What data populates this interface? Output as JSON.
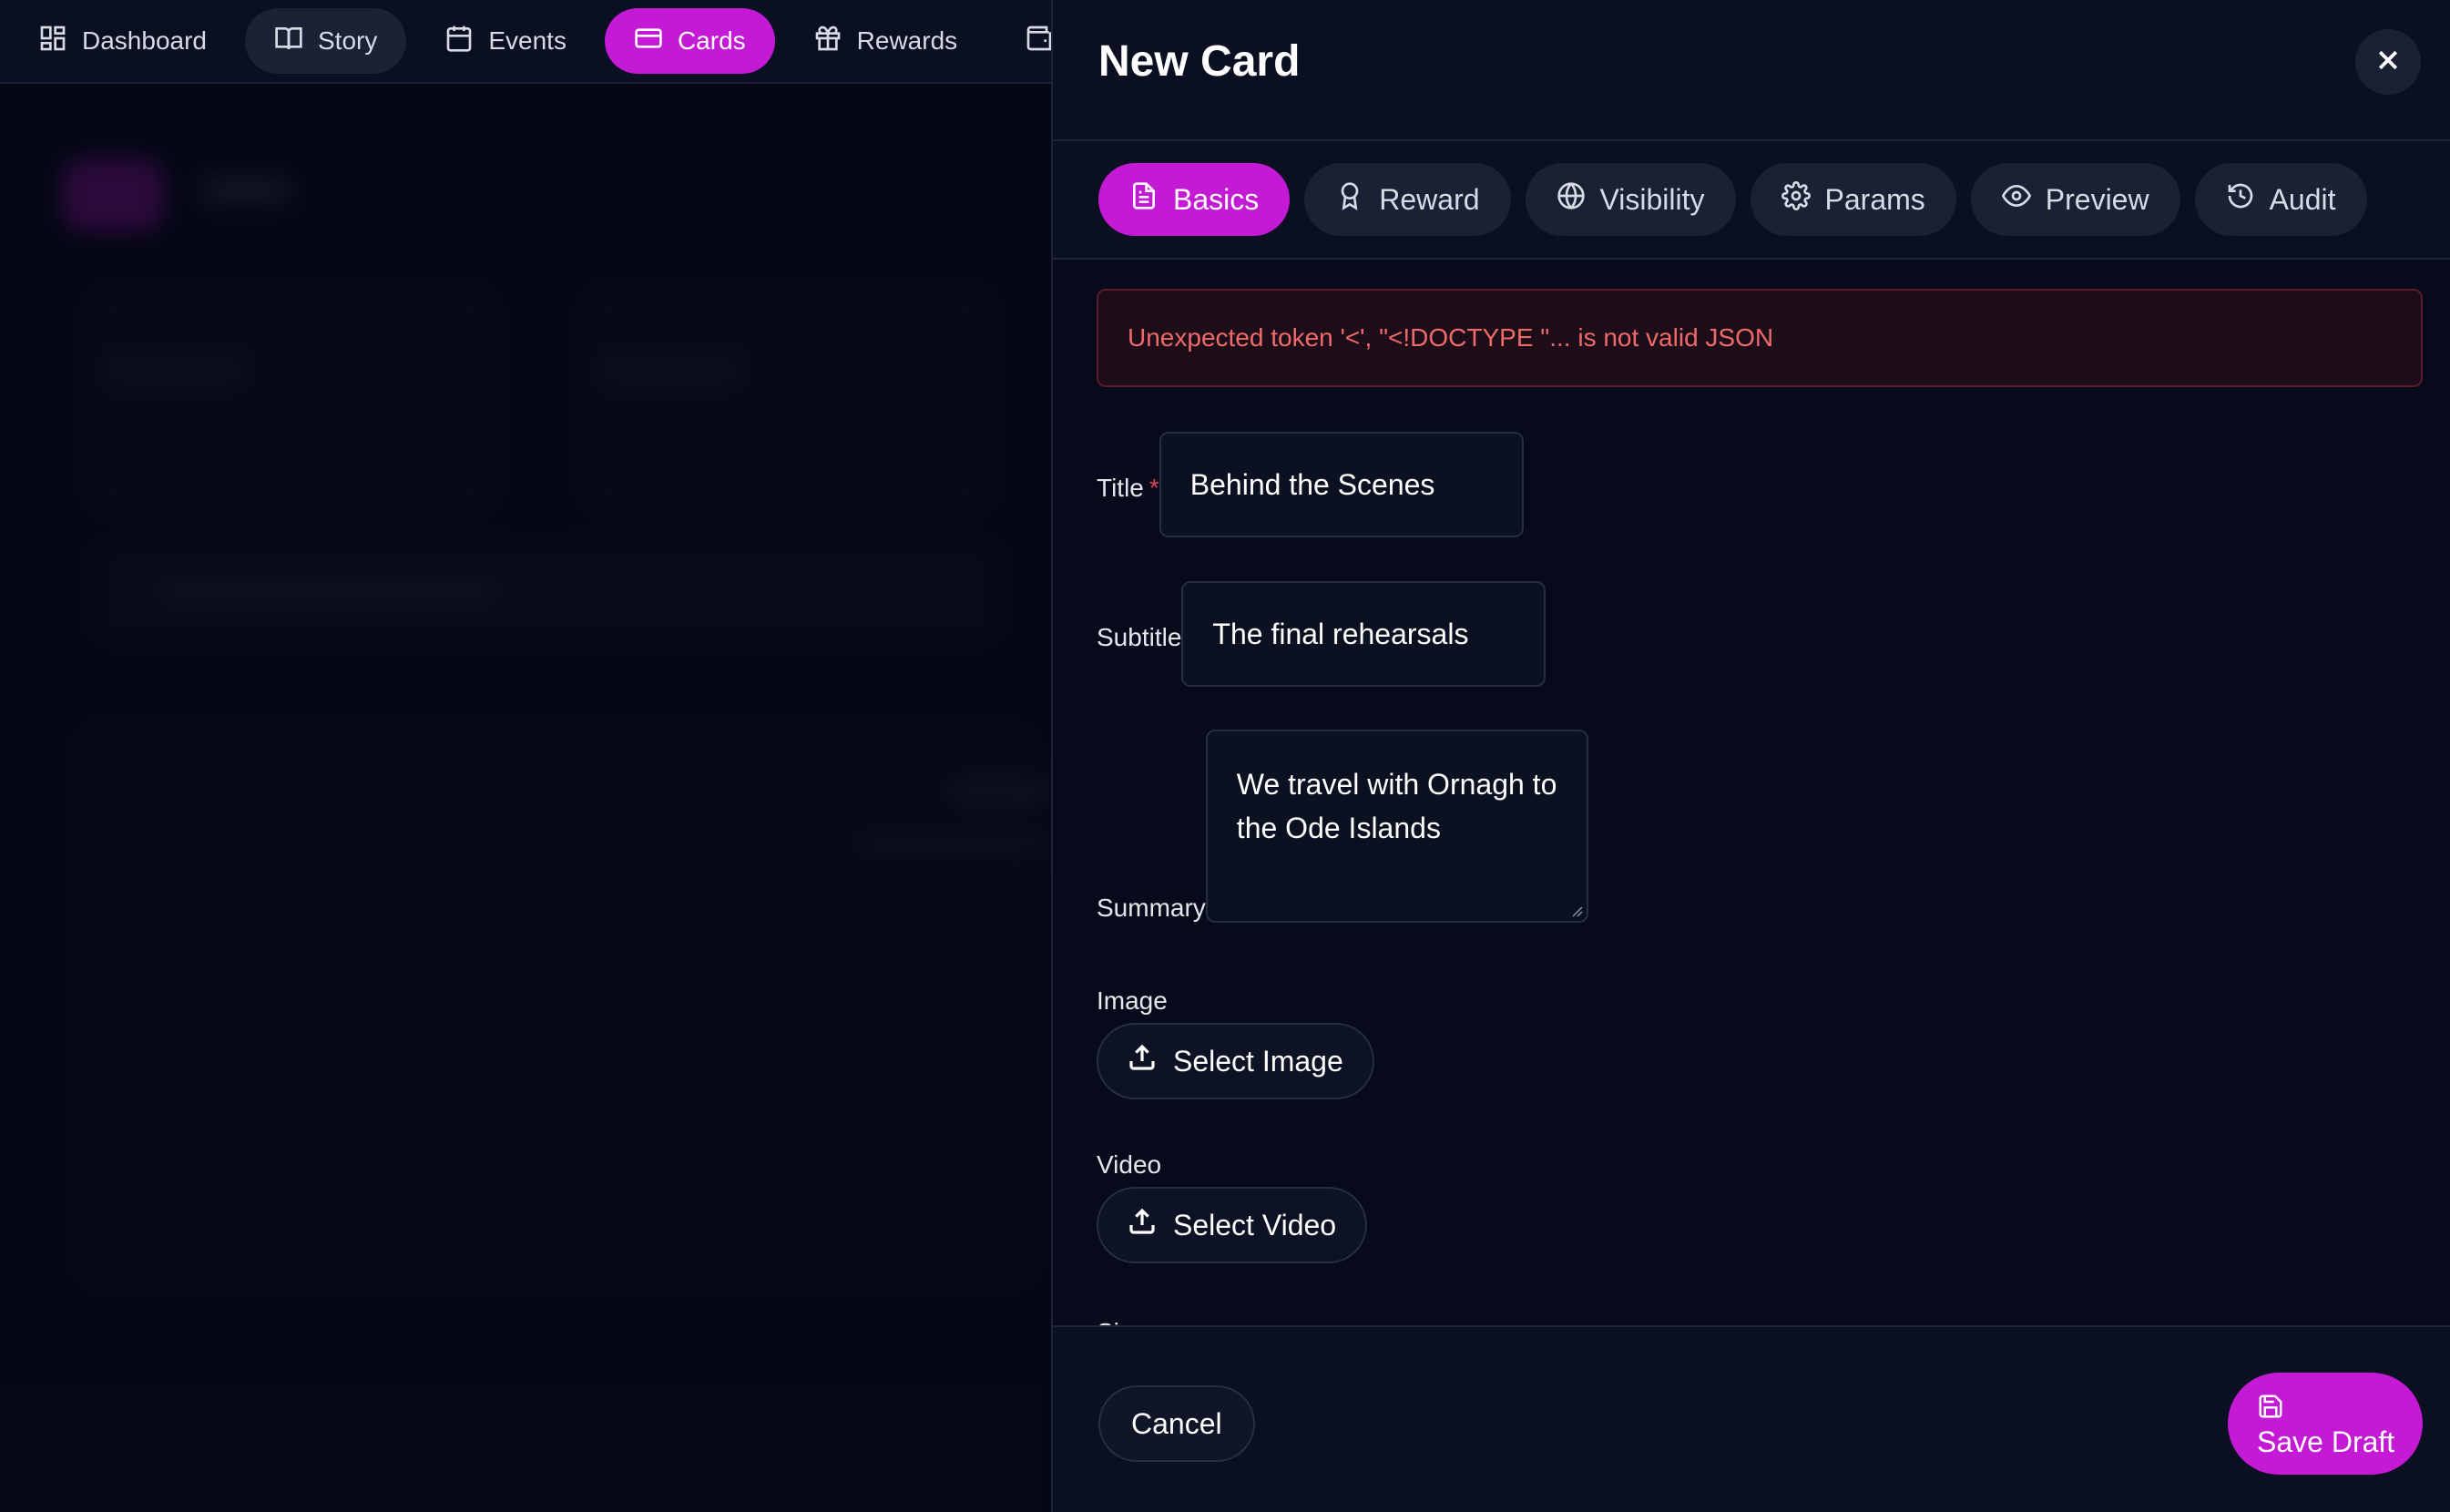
{
  "nav": {
    "items": [
      {
        "label": "Dashboard",
        "icon": "dashboard-icon"
      },
      {
        "label": "Story",
        "icon": "book-icon"
      },
      {
        "label": "Events",
        "icon": "calendar-icon"
      },
      {
        "label": "Cards",
        "icon": "card-icon"
      },
      {
        "label": "Rewards",
        "icon": "gift-icon"
      },
      {
        "label": "",
        "icon": "wallet-icon"
      }
    ],
    "active": "Cards"
  },
  "drawer": {
    "title": "New Card",
    "close_icon": "close-icon",
    "tabs": [
      {
        "label": "Basics",
        "icon": "document-icon"
      },
      {
        "label": "Reward",
        "icon": "award-icon"
      },
      {
        "label": "Visibility",
        "icon": "globe-icon"
      },
      {
        "label": "Params",
        "icon": "gear-icon"
      },
      {
        "label": "Preview",
        "icon": "eye-icon"
      },
      {
        "label": "Audit",
        "icon": "history-icon"
      }
    ],
    "active_tab": "Basics",
    "error": "Unexpected token '<', \"<!DOCTYPE \"... is not valid JSON",
    "form": {
      "title_label": "Title",
      "required_mark": "*",
      "title_value": "Behind the Scenes",
      "subtitle_label": "Subtitle",
      "subtitle_value": "The final rehearsals",
      "summary_label": "Summary",
      "summary_value": "We travel with Ornagh to the Ode Islands",
      "image_label": "Image",
      "image_button": "Select Image",
      "video_label": "Video",
      "video_button": "Select Video",
      "size_label": "Size"
    },
    "footer": {
      "cancel": "Cancel",
      "save": "Save Draft"
    }
  },
  "colors": {
    "accent": "#c41ad6",
    "error_text": "#f06a6a",
    "background": "#060a1a"
  }
}
